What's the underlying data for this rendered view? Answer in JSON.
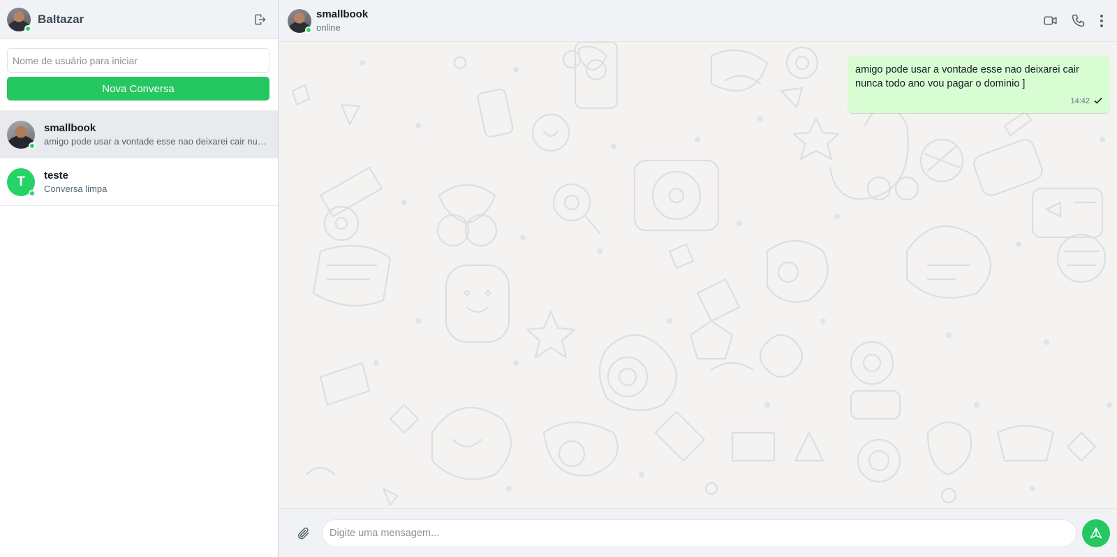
{
  "sidebar": {
    "username": "Baltazar",
    "new_chat": {
      "placeholder": "Nome de usuário para iniciar",
      "button_label": "Nova Conversa"
    },
    "chats": [
      {
        "name": "smallbook",
        "preview": "amigo pode usar a vontade esse nao deixarei cair nunca todo ano vou pagar o dominio ]",
        "avatar": "photo",
        "online": true,
        "active": true
      },
      {
        "name": "teste",
        "preview": "Conversa limpa",
        "avatar_letter": "T",
        "online": true,
        "active": false
      }
    ]
  },
  "header": {
    "contact_name": "smallbook",
    "status": "online"
  },
  "messages": [
    {
      "direction": "outgoing",
      "text": "amigo pode usar a vontade esse nao deixarei cair nunca todo ano vou pagar o dominio ]",
      "time": "14:42",
      "status_icon": "check-icon"
    }
  ],
  "composer": {
    "placeholder": "Digite uma mensagem..."
  },
  "colors": {
    "accent": "#25c760",
    "online": "#25d366",
    "outgoing_bubble": "#d9fdd3",
    "header_bg": "#f0f2f5"
  },
  "icons": {
    "logout": "logout-icon",
    "video": "video-call-icon",
    "phone": "phone-icon",
    "menu": "more-vertical-icon",
    "attach": "paperclip-icon",
    "send": "send-icon"
  }
}
